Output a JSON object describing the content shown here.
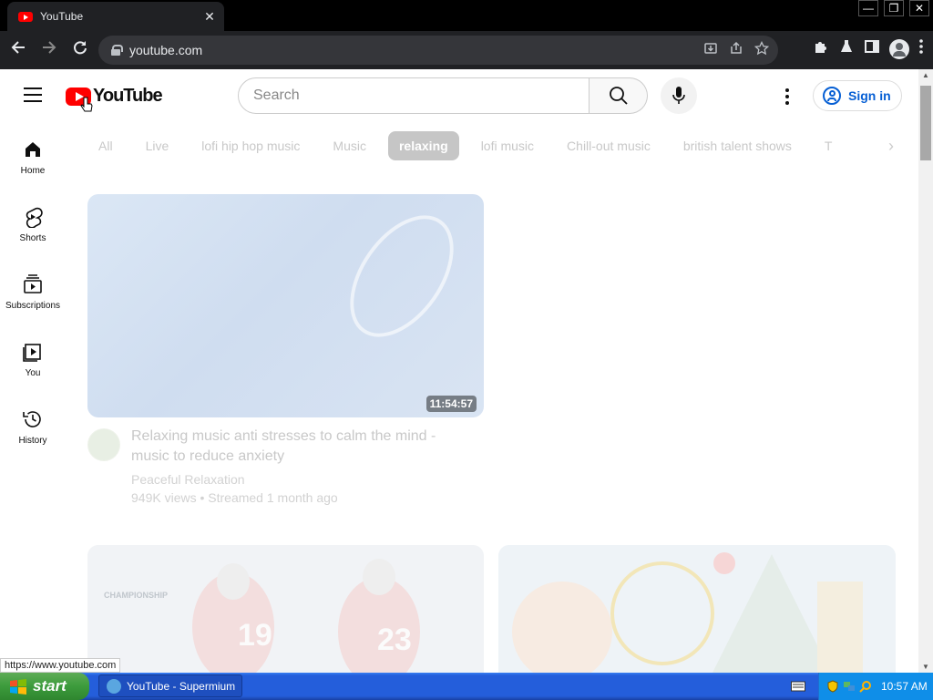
{
  "browser": {
    "tab_title": "YouTube",
    "tab_close": "✕",
    "url": "youtube.com",
    "window_buttons": [
      "—",
      "❐",
      "✕"
    ],
    "status_url": "https://www.youtube.com"
  },
  "masthead": {
    "logo_text": "YouTube",
    "search_placeholder": "Search",
    "sign_in": "Sign in"
  },
  "guide": {
    "items": [
      {
        "label": "Home",
        "icon": "home-icon"
      },
      {
        "label": "Shorts",
        "icon": "shorts-icon"
      },
      {
        "label": "Subscriptions",
        "icon": "subscriptions-icon"
      },
      {
        "label": "You",
        "icon": "you-icon"
      },
      {
        "label": "History",
        "icon": "history-icon"
      }
    ]
  },
  "chips": [
    {
      "label": "All",
      "active": false
    },
    {
      "label": "Live",
      "active": false
    },
    {
      "label": "lofi hip hop music",
      "active": false
    },
    {
      "label": "Music",
      "active": false
    },
    {
      "label": "relaxing",
      "active": true
    },
    {
      "label": "lofi music",
      "active": false
    },
    {
      "label": "Chill-out music",
      "active": false
    },
    {
      "label": "british talent shows",
      "active": false
    },
    {
      "label": "T",
      "active": false
    }
  ],
  "videos": [
    {
      "title": "Relaxing music anti stresses to calm the mind - music to reduce anxiety",
      "channel": "Peaceful Relaxation",
      "meta": "949K views • Streamed 1 month ago",
      "duration": "11:54:57"
    },
    {
      "thumb_text": "CHAMPIONSHIP"
    }
  ],
  "taskbar": {
    "start_label": "start",
    "task_label": "YouTube - Supermium",
    "clock": "10:57 AM"
  },
  "colors": {
    "brand_red": "#ff0000",
    "link_blue": "#065fd4",
    "xp_blue": "#245edb",
    "start_green": "#3c9b3c"
  }
}
